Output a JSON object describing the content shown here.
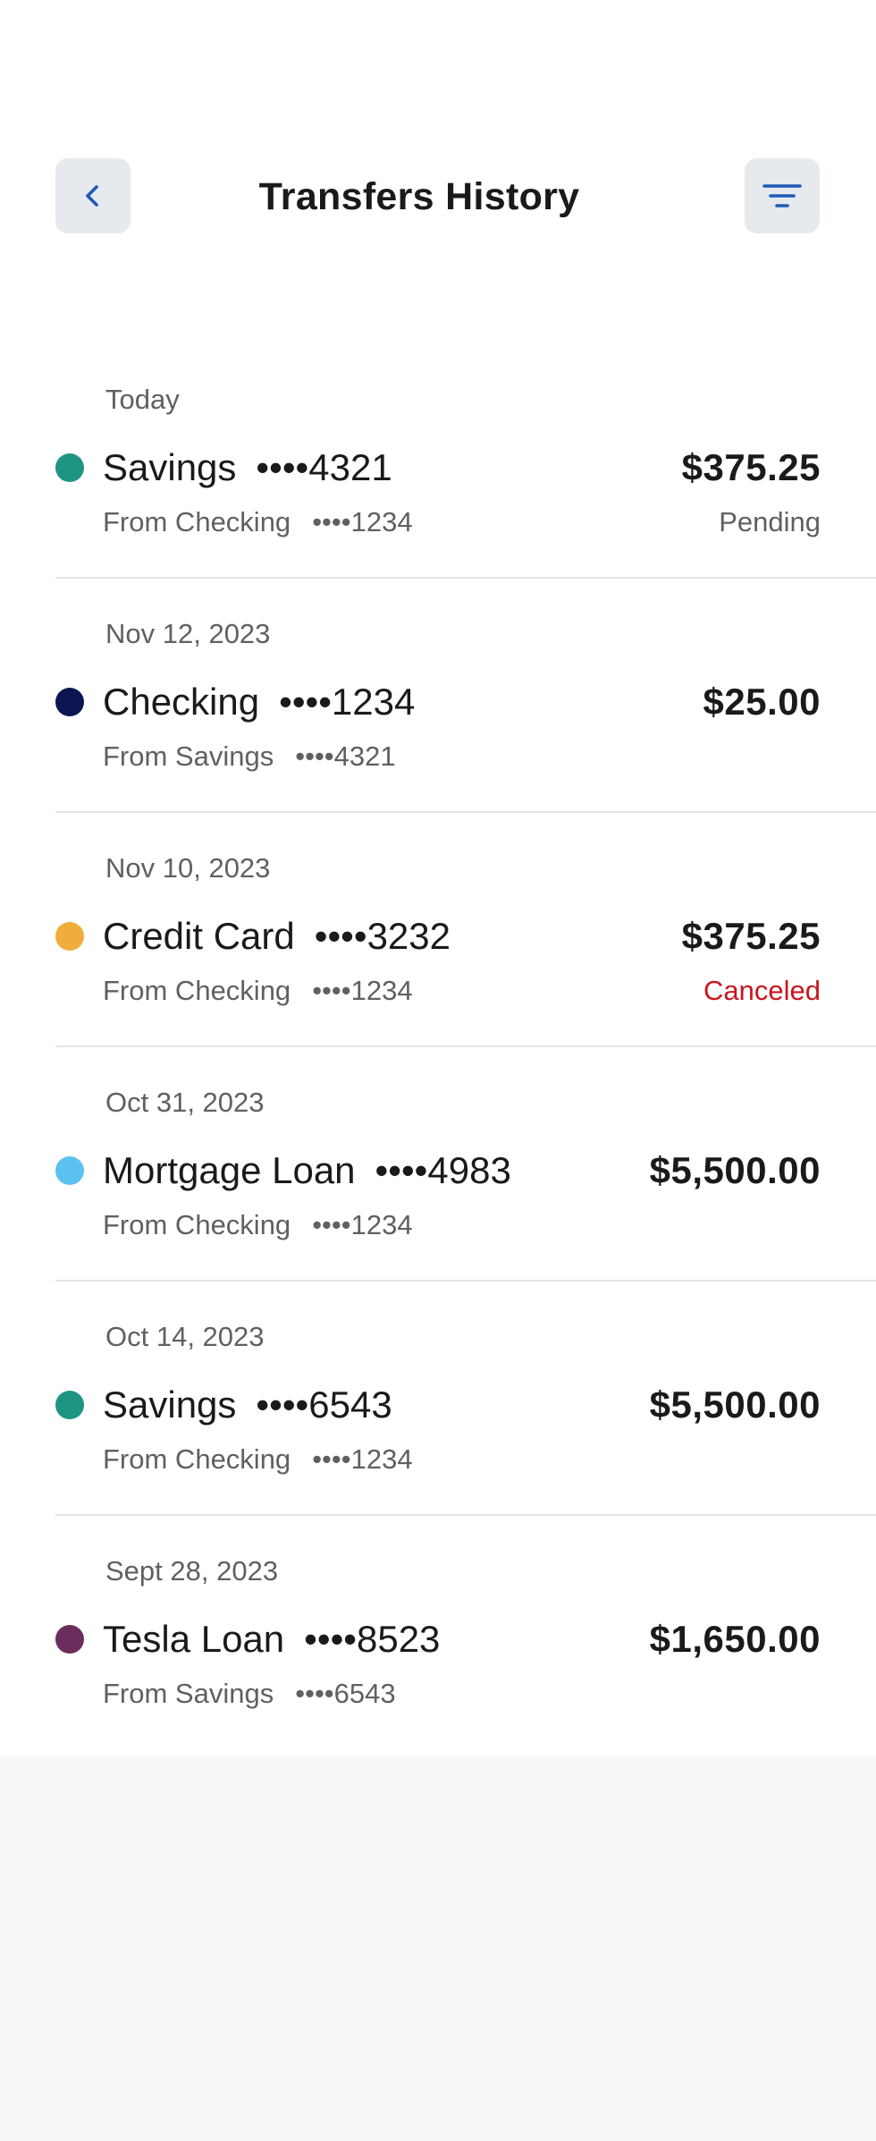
{
  "header": {
    "title": "Transfers History",
    "back_icon": "chevron-left-icon",
    "filter_icon": "filter-icon",
    "accent_color": "#1f5bb8"
  },
  "transfers": [
    {
      "date": "Today",
      "account": "Savings",
      "account_mask": "••••4321",
      "from": "From Checking",
      "from_mask": "••••1234",
      "amount": "$375.25",
      "status": "Pending",
      "status_color": "#606060",
      "dot_color": "#1e9583"
    },
    {
      "date": "Nov 12, 2023",
      "account": "Checking",
      "account_mask": "••••1234",
      "from": "From Savings",
      "from_mask": "••••4321",
      "amount": "$25.00",
      "status": "",
      "status_color": "#606060",
      "dot_color": "#0b1650"
    },
    {
      "date": "Nov 10, 2023",
      "account": "Credit Card",
      "account_mask": "••••3232",
      "from": "From Checking",
      "from_mask": "••••1234",
      "amount": "$375.25",
      "status": "Canceled",
      "status_color": "#c8161d",
      "dot_color": "#f0ad3b"
    },
    {
      "date": "Oct 31, 2023",
      "account": "Mortgage Loan",
      "account_mask": "••••4983",
      "from": "From Checking",
      "from_mask": "••••1234",
      "amount": "$5,500.00",
      "status": "",
      "status_color": "#606060",
      "dot_color": "#5bc2f0"
    },
    {
      "date": "Oct 14, 2023",
      "account": "Savings",
      "account_mask": "••••6543",
      "from": "From Checking",
      "from_mask": "••••1234",
      "amount": "$5,500.00",
      "status": "",
      "status_color": "#606060",
      "dot_color": "#1e9583"
    },
    {
      "date": "Sept 28, 2023",
      "account": "Tesla Loan",
      "account_mask": "••••8523",
      "from": "From Savings",
      "from_mask": "••••6543",
      "amount": "$1,650.00",
      "status": "",
      "status_color": "#606060",
      "dot_color": "#6b2d5c"
    }
  ]
}
